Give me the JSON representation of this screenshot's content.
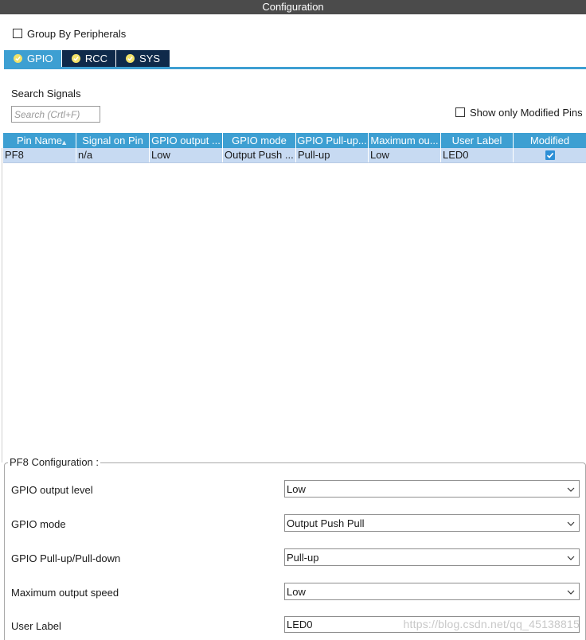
{
  "window": {
    "title": "Configuration"
  },
  "group_by": {
    "label": "Group By Peripherals",
    "checked": false
  },
  "tabs": [
    {
      "label": "GPIO",
      "active": true,
      "icon": "check-circle-icon"
    },
    {
      "label": "RCC",
      "active": false,
      "icon": "check-circle-icon"
    },
    {
      "label": "SYS",
      "active": false,
      "icon": "check-circle-icon"
    }
  ],
  "search": {
    "label": "Search Signals",
    "placeholder": "Search (Crtl+F)",
    "value": ""
  },
  "show_modified": {
    "label": "Show only Modified Pins",
    "checked": false
  },
  "table": {
    "columns": [
      "Pin Name",
      "Signal on Pin",
      "GPIO output ...",
      "GPIO mode",
      "GPIO Pull-up...",
      "Maximum ou...",
      "User Label",
      "Modified"
    ],
    "rows": [
      {
        "pin": "PF8",
        "signal": "n/a",
        "output_level": "Low",
        "mode": "Output Push ...",
        "pull": "Pull-up",
        "speed": "Low",
        "label": "LED0",
        "modified": true
      }
    ]
  },
  "config": {
    "legend": "PF8 Configuration :",
    "output_level": {
      "label": "GPIO output level",
      "value": "Low"
    },
    "mode": {
      "label": "GPIO mode",
      "value": "Output Push Pull"
    },
    "pull": {
      "label": "GPIO Pull-up/Pull-down",
      "value": "Pull-up"
    },
    "speed": {
      "label": "Maximum output speed",
      "value": "Low"
    },
    "user_label": {
      "label": "User Label",
      "value": "LED0"
    }
  },
  "watermark": "https://blog.csdn.net/qq_45138815",
  "colors": {
    "accent": "#3d9fd2",
    "tab_dark": "#0f2a4a",
    "row_selected": "#c7daf2",
    "titlebar": "#4b4b4b"
  }
}
